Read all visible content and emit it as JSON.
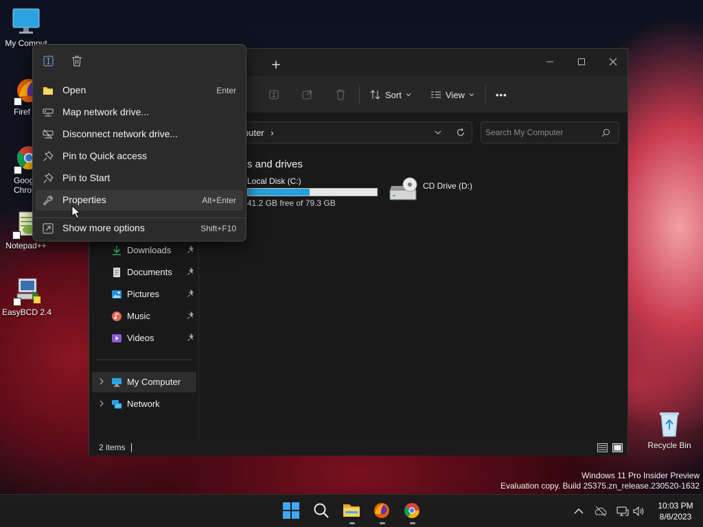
{
  "desktop": {
    "icons": [
      {
        "label": "My Comput",
        "icon": "monitor-icon"
      },
      {
        "label": "Firef",
        "icon": "firefox-icon"
      },
      {
        "label": "Goog",
        "label2": "Chron",
        "icon": "chrome-icon"
      },
      {
        "label": "Notepad++",
        "icon": "notepad-plus-plus-icon"
      },
      {
        "label": "EasyBCD 2.4",
        "icon": "easybcd-icon"
      },
      {
        "label": "Recycle Bin",
        "icon": "recycle-bin-icon"
      }
    ]
  },
  "explorer": {
    "new_tab_label": "+",
    "toolbar": {
      "sort_label": "Sort",
      "view_label": "View",
      "more_label": "•••"
    },
    "address": {
      "path": "puter",
      "separator": "›"
    },
    "search": {
      "placeholder": "Search My Computer"
    },
    "nav": {
      "quick_access": [
        {
          "label": "Downloads",
          "icon": "download-icon"
        },
        {
          "label": "Documents",
          "icon": "document-icon"
        },
        {
          "label": "Pictures",
          "icon": "pictures-icon"
        },
        {
          "label": "Music",
          "icon": "music-icon"
        },
        {
          "label": "Videos",
          "icon": "videos-icon"
        }
      ],
      "my_computer": "My Computer",
      "network": "Network"
    },
    "content": {
      "section_heading": "s and drives",
      "drives": [
        {
          "name": "Local Disk (C:)",
          "free_text": "41.2 GB free of 79.3 GB",
          "used_fraction": 0.48
        },
        {
          "name": "CD Drive (D:)"
        }
      ]
    },
    "status": {
      "items_count": "2 items"
    }
  },
  "context_menu": {
    "items": [
      {
        "label": "Open",
        "shortcut": "Enter"
      },
      {
        "label": "Map network drive...",
        "shortcut": ""
      },
      {
        "label": "Disconnect network drive...",
        "shortcut": ""
      },
      {
        "label": "Pin to Quick access",
        "shortcut": ""
      },
      {
        "label": "Pin to Start",
        "shortcut": ""
      },
      {
        "label": "Properties",
        "shortcut": "Alt+Enter"
      },
      {
        "label": "Show more options",
        "shortcut": "Shift+F10"
      }
    ]
  },
  "watermark": {
    "line1": "Windows 11 Pro Insider Preview",
    "line2": "Evaluation copy. Build 25375.zn_release.230520-1632"
  },
  "taskbar": {
    "time": "10:03 PM",
    "date": "8/6/2023"
  },
  "colors": {
    "accent": "#26a0da",
    "folder_yellow": "#f3c43f"
  }
}
